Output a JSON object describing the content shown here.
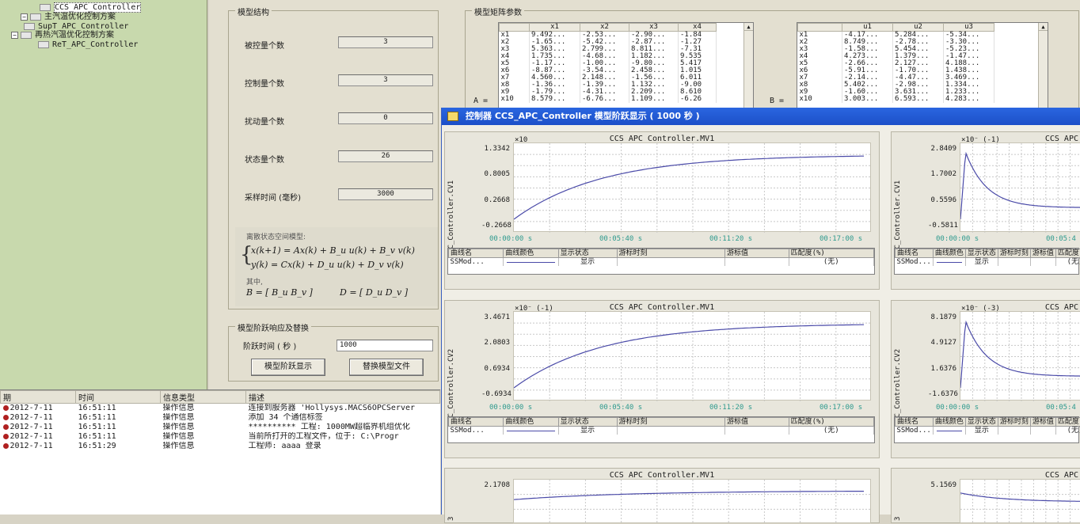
{
  "tree": {
    "items": [
      {
        "label": "CCS_APC_Controller",
        "type": "leaf",
        "selected": true
      },
      {
        "label": "主汽温优化控制方案",
        "type": "folder"
      },
      {
        "label": "SupT_APC_Controller",
        "type": "leaf"
      },
      {
        "label": "再热汽温优化控制方案",
        "type": "folder"
      },
      {
        "label": "ReT_APC_Controller",
        "type": "leaf"
      }
    ]
  },
  "model_structure": {
    "title": "模型结构",
    "fields": [
      {
        "label": "被控量个数",
        "value": "3"
      },
      {
        "label": "控制量个数",
        "value": "3"
      },
      {
        "label": "扰动量个数",
        "value": "0"
      },
      {
        "label": "状态量个数",
        "value": "26"
      },
      {
        "label": "采样时间 (毫秒)",
        "value": "3000"
      }
    ],
    "formula_caption": "离散状态空间模型:",
    "eq1": "x(k+1) = Ax(k) + B_u u(k) + B_v v(k)",
    "eq2": "y(k) = Cx(k) + D_u u(k) + D_v v(k)",
    "where": "其中,",
    "eqB": "B = [ B_u   B_v ]",
    "eqD": "D = [ D_u   D_v ]"
  },
  "step": {
    "title": "模型阶跃响应及替换",
    "time_label": "阶跃时间 ( 秒 )",
    "time_value": "1000",
    "show_button": "模型阶跃显示",
    "replace_button": "替换模型文件"
  },
  "matrix": {
    "title": "模型矩阵参数",
    "a_label": "A =",
    "b_label": "B =",
    "A": {
      "columns": [
        "",
        "x1",
        "x2",
        "x3",
        "x4"
      ],
      "rows": [
        [
          "x1",
          "9.492...",
          "-2.53...",
          "-2.90...",
          "-1.84"
        ],
        [
          "x2",
          "-1.65...",
          "-5.42...",
          "-2.87...",
          "-1.27"
        ],
        [
          "x3",
          "5.363...",
          "2.799...",
          "8.811...",
          "-7.31"
        ],
        [
          "x4",
          "1.735...",
          "-4.68...",
          "1.182...",
          "9.535"
        ],
        [
          "x5",
          "-1.17...",
          "-1.00...",
          "-9.80...",
          "5.417"
        ],
        [
          "x6",
          "-8.87...",
          "-3.54...",
          "2.458...",
          "1.015"
        ],
        [
          "x7",
          "4.560...",
          "2.148...",
          "-1.56...",
          "6.011"
        ],
        [
          "x8",
          "-1.36...",
          "-1.39...",
          "1.132...",
          "-9.00"
        ],
        [
          "x9",
          "-1.79...",
          "-4.31...",
          "2.209...",
          "8.610"
        ],
        [
          "x10",
          "8.579...",
          "-6.76...",
          "1.109...",
          "-6.26"
        ]
      ]
    },
    "B": {
      "columns": [
        "",
        "u1",
        "u2",
        "u3"
      ],
      "rows": [
        [
          "x1",
          "-4.17...",
          "5.284...",
          "-5.34..."
        ],
        [
          "x2",
          "8.749...",
          "-2.78...",
          "-3.30..."
        ],
        [
          "x3",
          "-1.58...",
          "5.454...",
          "-5.23..."
        ],
        [
          "x4",
          "4.273...",
          "1.379...",
          "-1.47..."
        ],
        [
          "x5",
          "-2.66...",
          "2.127...",
          "4.188..."
        ],
        [
          "x6",
          "-5.91...",
          "-1.70...",
          "1.438..."
        ],
        [
          "x7",
          "-2.14...",
          "-4.47...",
          "3.469..."
        ],
        [
          "x8",
          "5.402...",
          "-2.98...",
          "1.334..."
        ],
        [
          "x9",
          "-1.60...",
          "3.631...",
          "1.233..."
        ],
        [
          "x10",
          "3.003...",
          "6.593...",
          "4.283..."
        ]
      ]
    }
  },
  "log": {
    "columns": [
      "期",
      "时间",
      "信息类型",
      "描述"
    ],
    "rows": [
      [
        "2012-7-11",
        "16:51:11",
        "操作信息",
        "连接到服务器 'Hollysys.MACS6OPCServer"
      ],
      [
        "2012-7-11",
        "16:51:11",
        "操作信息",
        "添加 34 个通信标签"
      ],
      [
        "2012-7-11",
        "16:51:11",
        "操作信息",
        "********** 工程: 1000MW超临界机组优化"
      ],
      [
        "2012-7-11",
        "16:51:11",
        "操作信息",
        "当前所打开的工程文件，位于: C:\\Progr"
      ],
      [
        "2012-7-11",
        "16:51:29",
        "操作信息",
        "工程师: aaaa 登录"
      ]
    ]
  },
  "window": {
    "title": "控制器 CCS_APC_Controller 模型阶跃显示 ( 1000 秒 )",
    "legend_headers": [
      "曲线名",
      "曲线颜色",
      "显示状态",
      "游标时刻",
      "游标值",
      "匹配度(%)"
    ],
    "legend_row": {
      "name": "SSMod...",
      "state": "显示",
      "match": "(无)"
    },
    "x_ticks": [
      "00:00:00 s",
      "00:05:40 s",
      "00:11:20 s",
      "00:17:00 s"
    ],
    "x_ticks_short": [
      "00:00:00 s",
      "00:05:4"
    ],
    "line_color": "#4a4aa8",
    "left_panels": [
      {
        "title": "CCS_APC_Controller.MV1",
        "ylabel": "CCS_APC_Controller.CV1",
        "exp": "×10",
        "ticks": [
          "1.3342",
          "0.8005",
          "0.2668",
          "-0.2668"
        ]
      },
      {
        "title": "CCS_APC_Controller.MV1",
        "ylabel": "CCS_APC_Controller.CV2",
        "exp": "×10⁻ (-1)",
        "ticks": [
          "3.4671",
          "2.0803",
          "0.6934",
          "-0.6934"
        ]
      },
      {
        "title": "CCS_APC_Controller.MV1",
        "ylabel": "3",
        "exp": "",
        "ticks": [
          "2.1708"
        ]
      }
    ],
    "right_panels": [
      {
        "title": "CCS_APC",
        "ylabel": "CCS_APC_Controller.CV1",
        "exp": "×10⁻ (-1)",
        "ticks": [
          "2.8409",
          "1.7002",
          "0.5596",
          "-0.5811"
        ]
      },
      {
        "title": "CCS_APC",
        "ylabel": "CCS_APC_Controller.CV2",
        "exp": "×10⁻ (-3)",
        "ticks": [
          "8.1879",
          "4.9127",
          "1.6376",
          "-1.6376"
        ]
      },
      {
        "title": "CCS_APC",
        "ylabel": "3",
        "exp": "",
        "ticks": [
          "5.1569"
        ]
      }
    ]
  }
}
